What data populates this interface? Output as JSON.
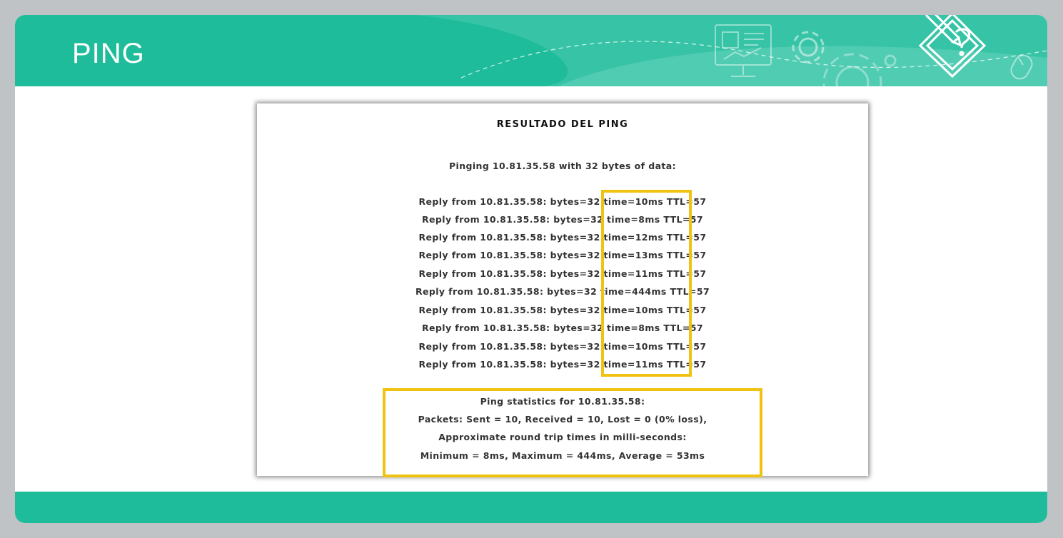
{
  "slide": {
    "title": "PING",
    "colors": {
      "accent": "#1ebc9a",
      "highlight": "#f0c313",
      "background": "#bfc3c6"
    },
    "decor_icons": [
      "presentation-board-icon",
      "gear-icon",
      "gear-large-icon",
      "pencil-question-icon",
      "mouse-icon"
    ]
  },
  "result": {
    "title": "RESULTADO DEL PING",
    "pinging_line": "Pinging 10.81.35.58 with 32 bytes of data:",
    "replies": [
      "Reply from 10.81.35.58: bytes=32 time=10ms TTL=57",
      "Reply from 10.81.35.58: bytes=32 time=8ms TTL=57",
      "Reply from 10.81.35.58: bytes=32 time=12ms TTL=57",
      "Reply from 10.81.35.58: bytes=32 time=13ms TTL=57",
      "Reply from 10.81.35.58: bytes=32 time=11ms TTL=57",
      "Reply from 10.81.35.58: bytes=32 time=444ms TTL=57",
      "Reply from 10.81.35.58: bytes=32 time=10ms TTL=57",
      "Reply from 10.81.35.58: bytes=32 time=8ms TTL=57",
      "Reply from 10.81.35.58: bytes=32 time=10ms TTL=57",
      "Reply from 10.81.35.58: bytes=32 time=11ms TTL=57"
    ],
    "statistics": {
      "header": "Ping statistics for 10.81.35.58:",
      "packets": "Packets: Sent = 10, Received = 10, Lost = 0 (0% loss),",
      "rtt_header": "Approximate round trip times in milli-seconds:",
      "rtt_values": "Minimum = 8ms, Maximum = 444ms, Average = 53ms"
    }
  }
}
